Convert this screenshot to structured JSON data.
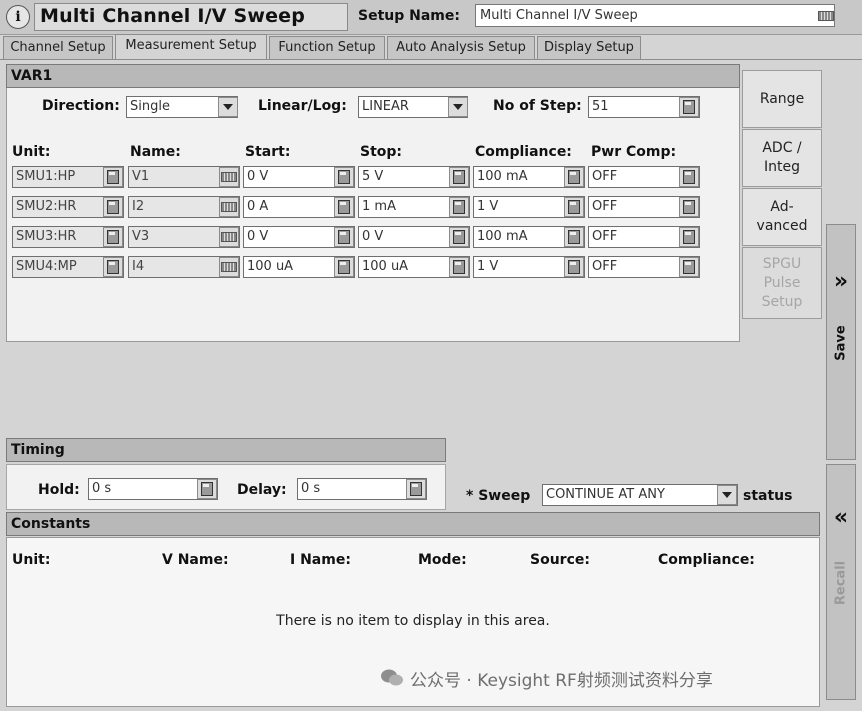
{
  "window": {
    "title": "Multi Channel I/V Sweep",
    "setup_name_label": "Setup Name:",
    "setup_name_value": "Multi Channel I/V Sweep"
  },
  "tabs": [
    {
      "label": "Channel Setup",
      "active": false
    },
    {
      "label": "Measurement Setup",
      "active": true
    },
    {
      "label": "Function Setup",
      "active": false
    },
    {
      "label": "Auto Analysis Setup",
      "active": false
    },
    {
      "label": "Display Setup",
      "active": false
    }
  ],
  "var1": {
    "header": "VAR1",
    "direction_label": "Direction:",
    "direction_value": "Single",
    "linlog_label": "Linear/Log:",
    "linlog_value": "LINEAR",
    "steps_label": "No of Step:",
    "steps_value": "51",
    "columns": [
      "Unit:",
      "Name:",
      "Start:",
      "Stop:",
      "Compliance:",
      "Pwr Comp:"
    ],
    "rows": [
      {
        "unit": "SMU1:HP",
        "name": "V1",
        "start": "0 V",
        "stop": "5 V",
        "compliance": "100 mA",
        "pwr": "OFF"
      },
      {
        "unit": "SMU2:HR",
        "name": "I2",
        "start": "0 A",
        "stop": "1 mA",
        "compliance": "1 V",
        "pwr": "OFF"
      },
      {
        "unit": "SMU3:HR",
        "name": "V3",
        "start": "0 V",
        "stop": "0 V",
        "compliance": "100 mA",
        "pwr": "OFF"
      },
      {
        "unit": "SMU4:MP",
        "name": "I4",
        "start": "100 uA",
        "stop": "100 uA",
        "compliance": "1 V",
        "pwr": "OFF"
      }
    ]
  },
  "side_buttons": {
    "range": "Range",
    "adc_l1": "ADC /",
    "adc_l2": "Integ",
    "adv_l1": "Ad-",
    "adv_l2": "vanced",
    "spgu_l1": "SPGU",
    "spgu_l2": "Pulse",
    "spgu_l3": "Setup"
  },
  "vertical_tabs": {
    "save": "Save",
    "recall": "Recall",
    "save_chevron": "»",
    "recall_chevron": "«"
  },
  "timing": {
    "header": "Timing",
    "hold_label": "Hold:",
    "hold_value": "0 s",
    "delay_label": "Delay:",
    "delay_value": "0 s",
    "sweep_label": "* Sweep",
    "sweep_value": "CONTINUE AT ANY",
    "status_label": "status"
  },
  "constants": {
    "header": "Constants",
    "columns": [
      "Unit:",
      "V Name:",
      "I Name:",
      "Mode:",
      "Source:",
      "Compliance:"
    ],
    "empty_message": "There is no item to display in this area."
  },
  "watermark": "公众号 · Keysight RF射频测试资料分享"
}
